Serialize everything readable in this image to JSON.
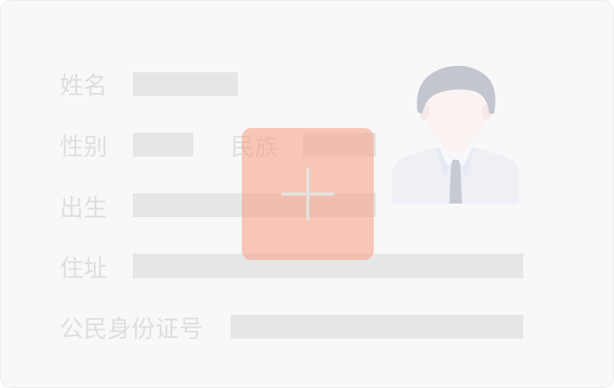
{
  "id_card": {
    "fields": {
      "name_label": "姓名",
      "sex_label": "性别",
      "ethnicity_label": "民族",
      "birth_label": "出生",
      "address_label": "住址",
      "id_number_label": "公民身份证号"
    },
    "portrait_icon": "person-portrait-icon",
    "upload_icon": "plus-icon"
  },
  "colors": {
    "card_background": "#f8f8f9",
    "label_text": "#dedede",
    "placeholder_bar": "#e6e6e7",
    "upload_overlay": "#f69e82",
    "plus_glyph": "#e4e1df",
    "hair": "#c3c6ce",
    "shirt": "#eef0f6",
    "skin": "#fbf3f2"
  }
}
